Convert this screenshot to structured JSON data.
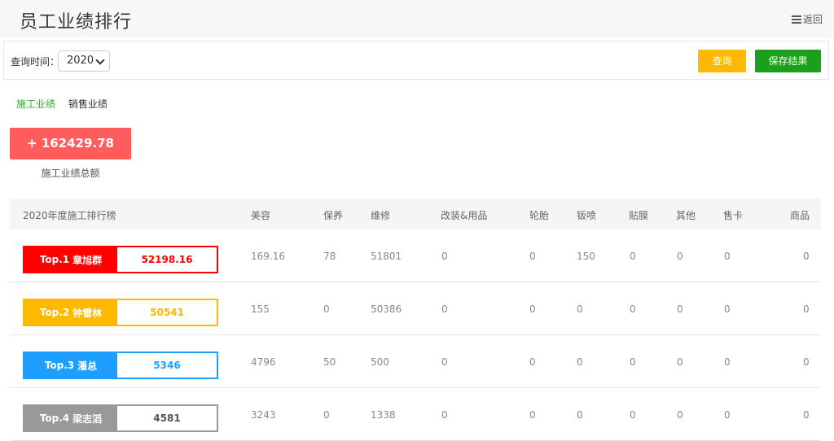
{
  "header": {
    "title": "员工业绩排行",
    "back_label": "返回"
  },
  "filter": {
    "label": "查询时间：",
    "year": "2020",
    "query_label": "查询",
    "save_label": "保存结果"
  },
  "tabs": [
    {
      "label": "施工业绩"
    },
    {
      "label": "销售业绩"
    }
  ],
  "summary": {
    "total": "+ 162429.78",
    "caption": "施工业绩总额"
  },
  "table": {
    "columns": [
      "2020年度施工排行榜",
      "美容",
      "保养",
      "维修",
      "改装&用品",
      "轮胎",
      "钣喷",
      "贴膜",
      "其他",
      "售卡",
      "商品"
    ],
    "rows": [
      {
        "rank": "Top.1",
        "name": "章旭群",
        "score": "52198.16",
        "color": "#ff0000",
        "values": [
          "169.16",
          "78",
          "51801",
          "0",
          "0",
          "150",
          "0",
          "0",
          "0",
          "0"
        ]
      },
      {
        "rank": "Top.2",
        "name": "钟雷林",
        "score": "50541",
        "color": "#ffb800",
        "values": [
          "155",
          "0",
          "50386",
          "0",
          "0",
          "0",
          "0",
          "0",
          "0",
          "0"
        ]
      },
      {
        "rank": "Top.3",
        "name": "潘总",
        "score": "5346",
        "color": "#1e9fff",
        "values": [
          "4796",
          "50",
          "500",
          "0",
          "0",
          "0",
          "0",
          "0",
          "0",
          "0"
        ]
      },
      {
        "rank": "Top.4",
        "name": "梁志滔",
        "score": "4581",
        "color": "#999999",
        "values": [
          "3243",
          "0",
          "1338",
          "0",
          "0",
          "0",
          "0",
          "0",
          "0",
          "0"
        ]
      }
    ]
  }
}
